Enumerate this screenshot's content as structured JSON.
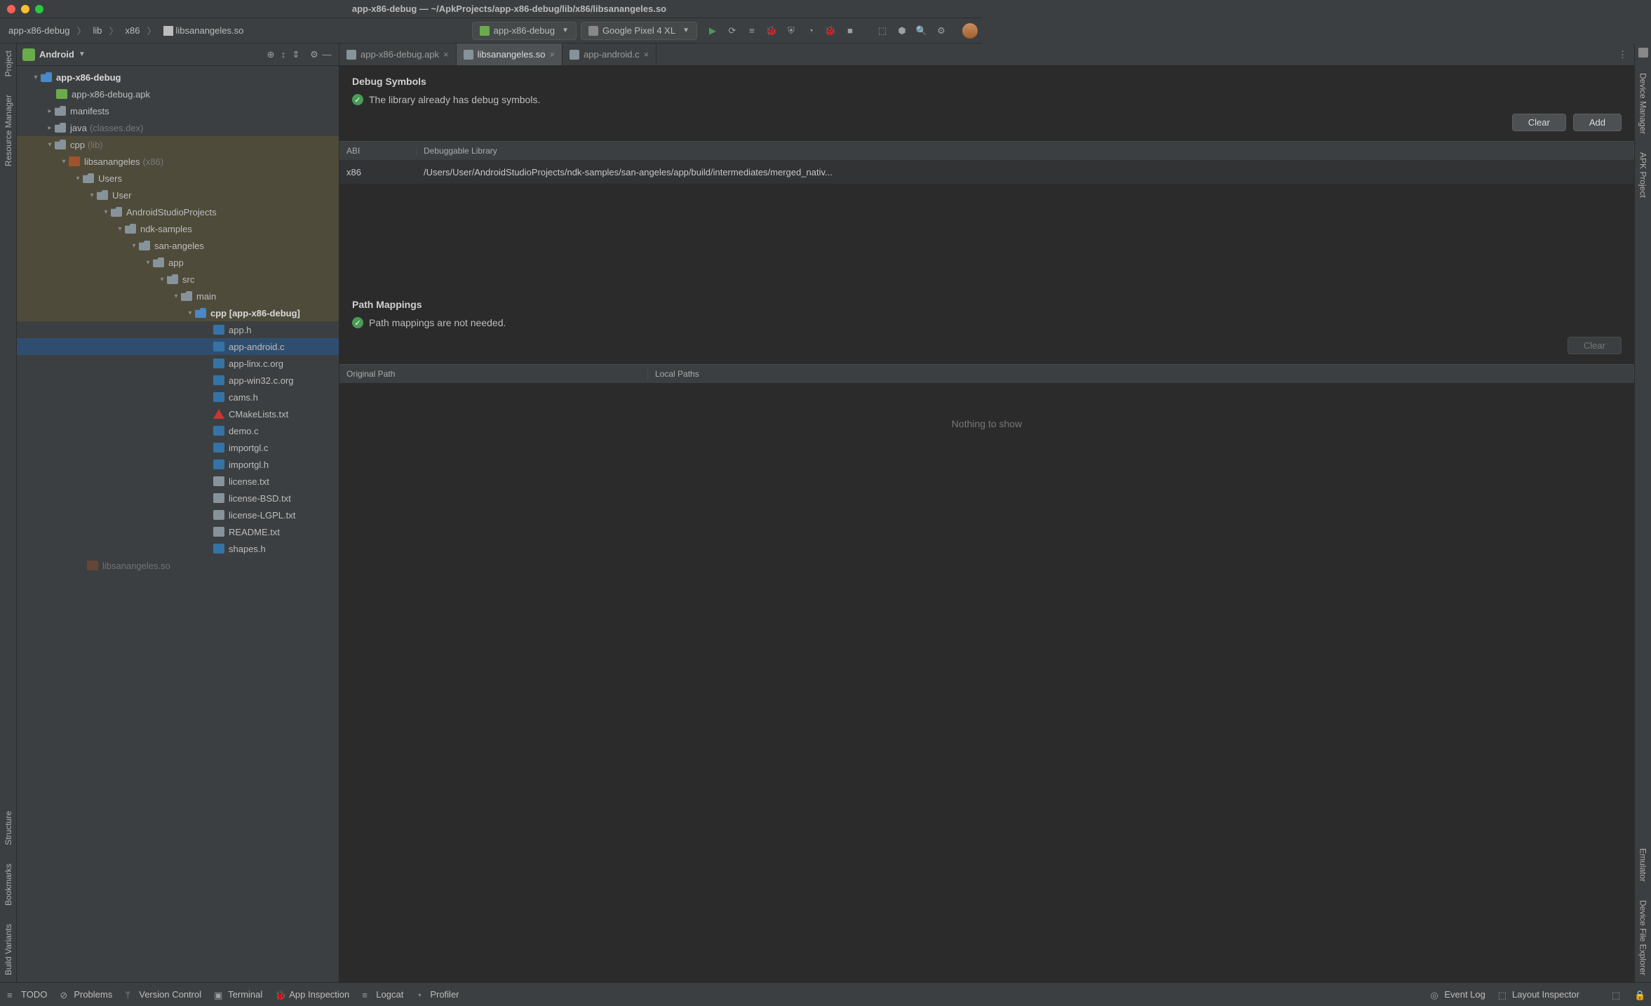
{
  "window_title": "app-x86-debug — ~/ApkProjects/app-x86-debug/lib/x86/libsanangeles.so",
  "breadcrumb": [
    "app-x86-debug",
    "lib",
    "x86",
    "libsanangeles.so"
  ],
  "run_config": "app-x86-debug",
  "device": "Google Pixel 4 XL",
  "project_selector": "Android",
  "left_tabs": [
    "Project",
    "Resource Manager",
    "Structure",
    "Bookmarks",
    "Build Variants"
  ],
  "right_tabs": [
    "Device Manager",
    "APK Project",
    "Emulator",
    "Device File Explorer"
  ],
  "tree": {
    "root": "app-x86-debug",
    "apk": "app-x86-debug.apk",
    "manifests": "manifests",
    "java": "java",
    "java_dim": "(classes.dex)",
    "cpp": "cpp",
    "cpp_dim": "(lib)",
    "lib": "libsanangeles",
    "lib_dim": "(x86)",
    "users": "Users",
    "user": "User",
    "asp": "AndroidStudioProjects",
    "ndk": "ndk-samples",
    "san": "san-angeles",
    "app": "app",
    "src": "src",
    "main": "main",
    "cppdir": "cpp",
    "cppdir_suffix": "[app-x86-debug]",
    "files": {
      "app_h": "app.h",
      "app_android_c": "app-android.c",
      "app_linx": "app-linx.c.org",
      "app_win32": "app-win32.c.org",
      "cams_h": "cams.h",
      "cmake": "CMakeLists.txt",
      "demo_c": "demo.c",
      "importgl_c": "importgl.c",
      "importgl_h": "importgl.h",
      "license": "license.txt",
      "license_bsd": "license-BSD.txt",
      "license_lgpl": "license-LGPL.txt",
      "readme": "README.txt",
      "shapes_h": "shapes.h",
      "so": "libsanangeles.so"
    }
  },
  "tabs": [
    {
      "label": "app-x86-debug.apk",
      "active": false
    },
    {
      "label": "libsanangeles.so",
      "active": true
    },
    {
      "label": "app-android.c",
      "active": false
    }
  ],
  "debug": {
    "title": "Debug Symbols",
    "status": "The library already has debug symbols.",
    "clear": "Clear",
    "add": "Add",
    "th_abi": "ABI",
    "th_lib": "Debuggable Library",
    "row_abi": "x86",
    "row_lib": "/Users/User/AndroidStudioProjects/ndk-samples/san-angeles/app/build/intermediates/merged_nativ..."
  },
  "paths": {
    "title": "Path Mappings",
    "status": "Path mappings are not needed.",
    "clear": "Clear",
    "th_orig": "Original Path",
    "th_local": "Local Paths",
    "nothing": "Nothing to show"
  },
  "statusbar": {
    "todo": "TODO",
    "problems": "Problems",
    "vcs": "Version Control",
    "terminal": "Terminal",
    "inspect": "App Inspection",
    "logcat": "Logcat",
    "profiler": "Profiler",
    "eventlog": "Event Log",
    "layout": "Layout Inspector"
  }
}
